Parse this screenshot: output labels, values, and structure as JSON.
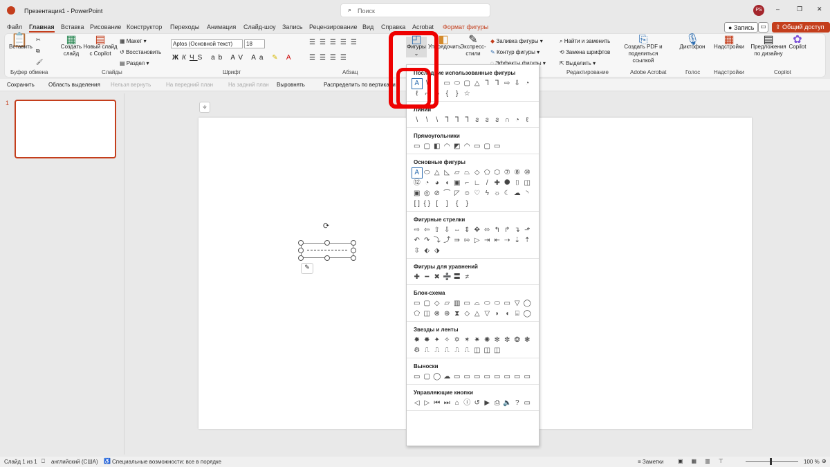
{
  "title": "Презентация1 - PowerPoint",
  "search_placeholder": "Поиск",
  "avatar": "PS",
  "tabs": [
    "Файл",
    "Главная",
    "Вставка",
    "Рисование",
    "Конструктор",
    "Переходы",
    "Анимация",
    "Слайд-шоу",
    "Запись",
    "Рецензирование",
    "Вид",
    "Справка",
    "Acrobat",
    "Формат фигуры"
  ],
  "record_btn": "Запись",
  "share_btn": "Общий доступ",
  "ribbon": {
    "paste": "Вставить",
    "clipboard": "Буфер обмена",
    "new_slide": "Создать слайд",
    "copilot_slide": "Новый слайд с Copilot",
    "layout": "Макет",
    "reset": "Восстановить",
    "section": "Раздел",
    "slides": "Слайды",
    "font_name": "Aptos (Основной текст)",
    "font_size": "18",
    "font": "Шрифт",
    "paragraph": "Абзац",
    "shapes": "Фигуры",
    "arrange": "Упорядочить",
    "quick_styles": "Экспресс-стили",
    "fill": "Заливка фигуры",
    "outline": "Контур фигуры",
    "effects": "Эффекты фигуры",
    "find": "Найти и заменить",
    "replace_fonts": "Замена шрифтов",
    "select": "Выделить",
    "editing": "Редактирование",
    "pdf": "Создать PDF и поделиться ссылкой",
    "acrobat": "Adobe Acrobat",
    "dictate": "Диктофон",
    "voice": "Голос",
    "addins": "Надстройки",
    "addins_grp": "Надстройки",
    "designer": "Предложения по дизайну",
    "copilot": "Copilot",
    "copilot_grp": "Copilot"
  },
  "qat": [
    "Сохранить",
    "Область выделения",
    "Нельзя вернуть",
    "На передний план",
    "На задний план",
    "Выровнять",
    "Распределить по вертикали"
  ],
  "slide_number": "1",
  "dropdown": {
    "sections": [
      {
        "title": "Последние использованные фигуры",
        "shapes": [
          "A",
          "\\",
          "\\",
          "▭",
          "⬭",
          "▢",
          "△",
          "⅂",
          "⅂",
          "⇨",
          "⇩",
          "◔",
          "ℓ",
          "⌐",
          "∿",
          "{",
          "}",
          "☆"
        ]
      },
      {
        "title": "Линии",
        "shapes": [
          "\\",
          "\\",
          "\\",
          "⅂",
          "⅂",
          "⅂",
          "ƨ",
          "ƨ",
          "ƨ",
          "∩",
          "◔",
          "ℓ"
        ]
      },
      {
        "title": "Прямоугольники",
        "shapes": [
          "▭",
          "▢",
          "◧",
          "◠",
          "◩",
          "◠",
          "▭",
          "▢",
          "▭"
        ]
      },
      {
        "title": "Основные фигуры",
        "shapes": [
          "A",
          "⬭",
          "△",
          "◺",
          "▱",
          "⏢",
          "◇",
          "⬠",
          "⬡",
          "⑦",
          "⑧",
          "⑩",
          "⑫",
          "◔",
          "◕",
          "◖",
          "▣",
          "⌐",
          "∟",
          "/",
          "✚",
          "⯃",
          "⌷",
          "◫",
          "▣",
          "◎",
          "⊘",
          "⌒",
          "◸",
          "☺",
          "♡",
          "ϟ",
          "☼",
          "☾",
          "☁",
          "◝",
          "[ ]",
          "{ }",
          "[",
          "]",
          "{",
          "}"
        ]
      },
      {
        "title": "Фигурные стрелки",
        "shapes": [
          "⇨",
          "⇦",
          "⇧",
          "⇩",
          "⇔",
          "⇕",
          "✥",
          "⬄",
          "↰",
          "↱",
          "↴",
          "⬏",
          "↶",
          "↷",
          "⤵",
          "⤴",
          "⇛",
          "⇰",
          "▷",
          "⇥",
          "⇤",
          "⇢",
          "⇣",
          "⇡",
          "⇳",
          "⬖",
          "⬗"
        ]
      },
      {
        "title": "Фигуры для уравнений",
        "shapes": [
          "✚",
          "━",
          "✖",
          "➗",
          "〓",
          "≠"
        ]
      },
      {
        "title": "Блок-схема",
        "shapes": [
          "▭",
          "▢",
          "◇",
          "▱",
          "▥",
          "▭",
          "⌓",
          "⬭",
          "⬭",
          "▭",
          "▽",
          "◯",
          "⬠",
          "◫",
          "⊗",
          "⊕",
          "⧗",
          "◇",
          "△",
          "▽",
          "◗",
          "◖",
          "⌸",
          "◯"
        ]
      },
      {
        "title": "Звезды и ленты",
        "shapes": [
          "✹",
          "✸",
          "✦",
          "✧",
          "✡",
          "✶",
          "✷",
          "✺",
          "✻",
          "✼",
          "❂",
          "❃",
          "⚙",
          "⎍",
          "⎍",
          "⎍",
          "⎍",
          "⎍",
          "◫",
          "◫",
          "◫"
        ]
      },
      {
        "title": "Выноски",
        "shapes": [
          "▭",
          "▢",
          "◯",
          "☁",
          "▭",
          "▭",
          "▭",
          "▭",
          "▭",
          "▭",
          "▭",
          "▭"
        ]
      },
      {
        "title": "Управляющие кнопки",
        "shapes": [
          "◁",
          "▷",
          "⏮",
          "⏭",
          "⌂",
          "ⓘ",
          "↺",
          "▶",
          "⎙",
          "🔈",
          "?",
          "▭"
        ]
      }
    ]
  },
  "status": {
    "slide": "Слайд 1 из 1",
    "lang": "английский (США)",
    "access": "Специальные возможности: все в порядке",
    "notes": "Заметки",
    "zoom": "100 %"
  }
}
